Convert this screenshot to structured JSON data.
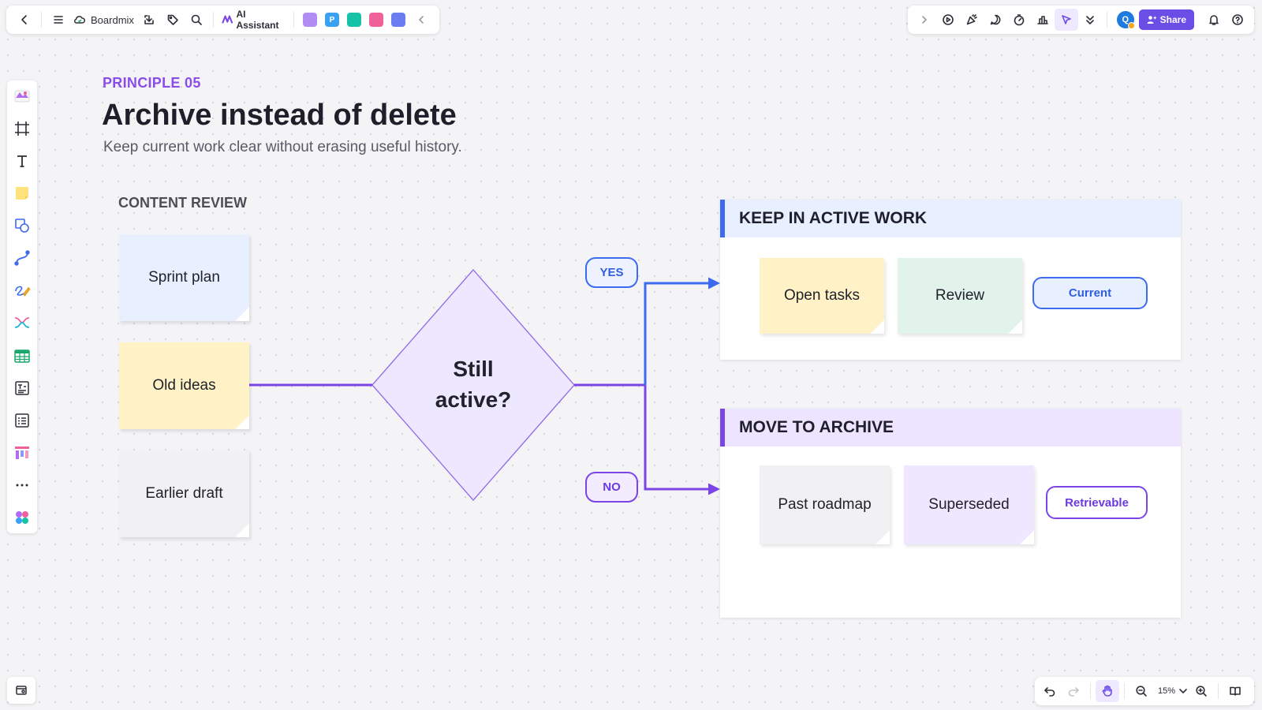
{
  "topbar": {
    "brand": "Boardmix",
    "ai_label": "AI Assistant",
    "apps": [
      {
        "glyph": "",
        "color": "#b18cf2"
      },
      {
        "glyph": "P",
        "color": "#3aa0f0"
      },
      {
        "glyph": "",
        "color": "#16c3a8"
      },
      {
        "glyph": "",
        "color": "#f0609a"
      },
      {
        "glyph": "",
        "color": "#6b7cf0"
      }
    ],
    "avatar_initial": "Q",
    "share_label": "Share"
  },
  "canvas": {
    "kicker": "PRINCIPLE 05",
    "title": "Archive instead of delete",
    "subtitle": "Keep current work clear without erasing useful history.",
    "section_label": "CONTENT REVIEW",
    "notes_left": [
      "Sprint plan",
      "Old ideas",
      "Earlier draft"
    ],
    "decision": {
      "line1": "Still",
      "line2": "active?"
    },
    "yes_label": "YES",
    "no_label": "NO",
    "keep_panel": {
      "heading": "KEEP IN ACTIVE WORK",
      "notes": [
        "Open tasks",
        "Review"
      ],
      "tag": "Current"
    },
    "archive_panel": {
      "heading": "MOVE TO ARCHIVE",
      "notes": [
        "Past roadmap",
        "Superseded"
      ],
      "tag": "Retrievable"
    }
  },
  "colors": {
    "accent_purple": "#7b45e6",
    "accent_blue": "#3d6bf0",
    "diamond_fill": "#ede7ff"
  },
  "bottombar": {
    "zoom": "15%"
  }
}
